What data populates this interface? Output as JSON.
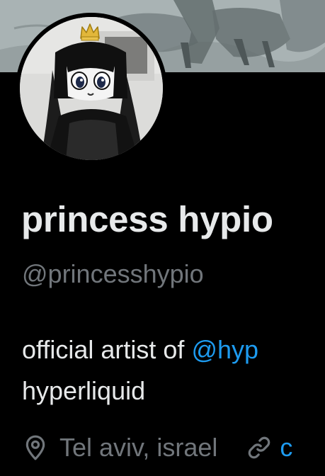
{
  "profile": {
    "display_name": "princess hypio",
    "handle": "@princesshypio",
    "bio_prefix": "official artist of ",
    "bio_mention": "@hyp",
    "bio_line2": "hyperliquid",
    "location": "Tel aviv, israel",
    "link_fragment": "c"
  },
  "icons": {
    "location": "location-pin-icon",
    "link": "link-icon",
    "crown": "crown-icon"
  },
  "colors": {
    "background": "#000000",
    "primary_text": "#e7e9ea",
    "secondary_text": "#71767b",
    "accent": "#1d9bf0",
    "crown": "#e2b73a"
  }
}
